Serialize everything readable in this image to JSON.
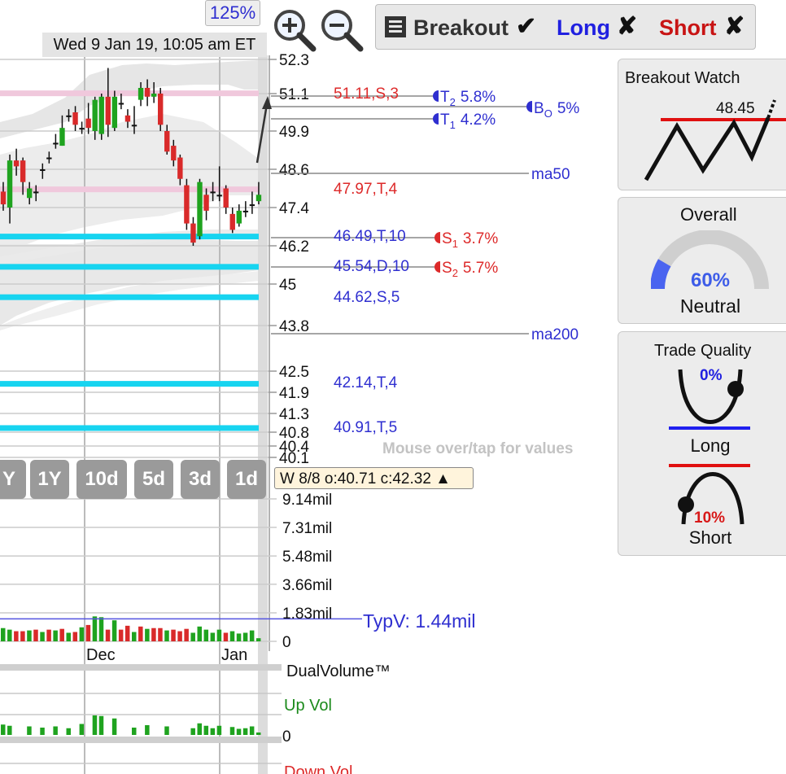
{
  "header": {
    "zoom_level": "125%",
    "timestamp": "Wed 9 Jan 19, 10:05 am ET",
    "toolbar": {
      "breakout_label": "Breakout",
      "breakout_mark": "✔",
      "long_label": "Long",
      "long_mark": "✘",
      "short_label": "Short",
      "short_mark": "✘"
    }
  },
  "range_buttons": [
    "Y",
    "1Y",
    "10d",
    "5d",
    "3d",
    "1d"
  ],
  "info_box": "W 8/8 o:40.71 c:42.32 ▲",
  "mouse_hint": "Mouse over/tap for values",
  "price_axis": {
    "ticks": [
      "52.3",
      "51.1",
      "49.9",
      "48.6",
      "47.4",
      "46.2",
      "45",
      "43.8",
      "42.5",
      "41.9",
      "41.3",
      "40.8",
      "40.4",
      "40.1"
    ]
  },
  "annotations": [
    {
      "text": "51.11,S,3",
      "color": "#dd2a2a"
    },
    {
      "text": "47.97,T,4",
      "color": "#dd2a2a"
    },
    {
      "text": "46.49,T,10",
      "color": "#2f2fd0"
    },
    {
      "text": "45.54,D,10",
      "color": "#2f2fd0"
    },
    {
      "text": "44.62,S,5",
      "color": "#2f2fd0"
    },
    {
      "text": "42.14,T,4",
      "color": "#2f2fd0"
    },
    {
      "text": "40.91,T,5",
      "color": "#2f2fd0"
    }
  ],
  "targets": {
    "t2": {
      "letter": "T",
      "sub": "2",
      "value": "5.8%"
    },
    "t1": {
      "letter": "T",
      "sub": "1",
      "value": "4.2%"
    },
    "bo": {
      "letter": "B",
      "sub": "O",
      "value": "5%"
    },
    "s1": {
      "letter": "S",
      "sub": "1",
      "value": "3.7%"
    },
    "s2": {
      "letter": "S",
      "sub": "2",
      "value": "5.7%"
    }
  },
  "ma_labels": {
    "ma50": "ma50",
    "ma200": "ma200"
  },
  "volume_axis": {
    "ticks": [
      "9.14mil",
      "7.31mil",
      "5.48mil",
      "3.66mil",
      "1.83mil",
      "0"
    ],
    "typv": "TypV: 1.44mil"
  },
  "month_labels": [
    "Dec",
    "Jan"
  ],
  "dual_volume": {
    "title": "DualVolume™",
    "up": "Up Vol",
    "zero": "0",
    "down": "Down Vol"
  },
  "panels": {
    "breakout_watch": {
      "title": "Breakout Watch",
      "level": "48.45"
    },
    "overall": {
      "title": "Overall",
      "percent": "60%",
      "label": "Neutral",
      "value": 0.6
    },
    "trade_quality": {
      "title": "Trade Quality",
      "long_pct": "0%",
      "long_label": "Long",
      "short_pct": "10%",
      "short_label": "Short"
    }
  },
  "colors": {
    "up": "#1fa31f",
    "down": "#d92a2a",
    "support": "#17d4f0",
    "resistance": "#f0c8dc",
    "blue_text": "#2f2fd0",
    "red_text": "#dd2a2a",
    "green_text": "#1b8a1b"
  },
  "chart_data": {
    "type": "candlestick",
    "ylim": [
      40.1,
      52.3
    ],
    "levels": [
      {
        "price": 51.11,
        "kind": "resistance"
      },
      {
        "price": 47.97,
        "kind": "resistance"
      },
      {
        "price": 46.49,
        "kind": "support"
      },
      {
        "price": 45.54,
        "kind": "support"
      },
      {
        "price": 44.62,
        "kind": "support"
      },
      {
        "price": 42.14,
        "kind": "support"
      },
      {
        "price": 40.91,
        "kind": "support"
      }
    ],
    "candles": [
      {
        "o": 47.9,
        "c": 47.5,
        "h": 48.2,
        "l": 47.3
      },
      {
        "o": 47.4,
        "c": 48.9,
        "h": 49.1,
        "l": 46.9
      },
      {
        "o": 48.9,
        "c": 48.7,
        "h": 49.3,
        "l": 48.4
      },
      {
        "o": 48.9,
        "c": 48.2,
        "h": 49.0,
        "l": 47.8
      },
      {
        "o": 47.7,
        "c": 48.0,
        "h": 48.2,
        "l": 47.5
      },
      {
        "o": 47.9,
        "c": 47.9,
        "h": 48.1,
        "l": 47.6
      },
      {
        "o": 48.6,
        "c": 48.6,
        "h": 48.8,
        "l": 48.3
      },
      {
        "o": 49.0,
        "c": 49.0,
        "h": 49.2,
        "l": 48.8
      },
      {
        "o": 49.5,
        "c": 49.5,
        "h": 49.8,
        "l": 49.3
      },
      {
        "o": 49.4,
        "c": 50.0,
        "h": 50.4,
        "l": 49.4
      },
      {
        "o": 50.4,
        "c": 50.4,
        "h": 50.6,
        "l": 50.2
      },
      {
        "o": 50.5,
        "c": 50.1,
        "h": 50.7,
        "l": 49.9
      },
      {
        "o": 50.0,
        "c": 50.0,
        "h": 50.2,
        "l": 49.8
      },
      {
        "o": 50.3,
        "c": 50.0,
        "h": 50.8,
        "l": 49.8
      },
      {
        "o": 49.9,
        "c": 50.9,
        "h": 51.0,
        "l": 49.6
      },
      {
        "o": 49.8,
        "c": 51.0,
        "h": 51.1,
        "l": 49.6
      },
      {
        "o": 51.0,
        "c": 50.1,
        "h": 52.0,
        "l": 49.7
      },
      {
        "o": 50.0,
        "c": 51.0,
        "h": 51.2,
        "l": 49.9
      },
      {
        "o": 50.8,
        "c": 50.8,
        "h": 51.1,
        "l": 50.6
      },
      {
        "o": 50.4,
        "c": 50.2,
        "h": 50.6,
        "l": 50.0
      },
      {
        "o": 50.1,
        "c": 50.1,
        "h": 50.7,
        "l": 49.8
      },
      {
        "o": 50.9,
        "c": 51.3,
        "h": 51.5,
        "l": 50.7
      },
      {
        "o": 51.3,
        "c": 51.0,
        "h": 51.6,
        "l": 50.7
      },
      {
        "o": 51.0,
        "c": 51.1,
        "h": 51.5,
        "l": 50.8
      },
      {
        "o": 51.1,
        "c": 50.1,
        "h": 51.3,
        "l": 49.9
      },
      {
        "o": 49.9,
        "c": 49.2,
        "h": 50.1,
        "l": 49.1
      },
      {
        "o": 49.4,
        "c": 48.9,
        "h": 49.6,
        "l": 48.7
      },
      {
        "o": 49.0,
        "c": 48.3,
        "h": 49.1,
        "l": 48.1
      },
      {
        "o": 48.1,
        "c": 46.9,
        "h": 48.3,
        "l": 46.7
      },
      {
        "o": 46.9,
        "c": 46.3,
        "h": 47.1,
        "l": 46.2
      },
      {
        "o": 46.5,
        "c": 48.2,
        "h": 48.3,
        "l": 46.4
      },
      {
        "o": 47.8,
        "c": 47.3,
        "h": 48.0,
        "l": 47.0
      },
      {
        "o": 47.9,
        "c": 47.9,
        "h": 48.2,
        "l": 47.6
      },
      {
        "o": 47.8,
        "c": 47.8,
        "h": 48.7,
        "l": 47.6
      },
      {
        "o": 48.0,
        "c": 47.4,
        "h": 48.1,
        "l": 47.2
      },
      {
        "o": 47.2,
        "c": 46.7,
        "h": 47.4,
        "l": 46.6
      },
      {
        "o": 46.9,
        "c": 47.3,
        "h": 47.5,
        "l": 46.8
      },
      {
        "o": 47.3,
        "c": 47.3,
        "h": 47.6,
        "l": 47.1
      },
      {
        "o": 47.5,
        "c": 47.5,
        "h": 47.9,
        "l": 47.2
      },
      {
        "o": 47.6,
        "c": 47.8,
        "h": 48.2,
        "l": 47.5
      }
    ],
    "volume": {
      "ylim": [
        0,
        9.14
      ],
      "typical": 1.44,
      "bars": [
        {
          "v": 0.85,
          "up": true
        },
        {
          "v": 0.75,
          "up": true
        },
        {
          "v": 0.65,
          "up": false
        },
        {
          "v": 0.65,
          "up": false
        },
        {
          "v": 0.7,
          "up": true
        },
        {
          "v": 0.75,
          "up": false
        },
        {
          "v": 0.6,
          "up": true
        },
        {
          "v": 0.75,
          "up": false
        },
        {
          "v": 0.7,
          "up": true
        },
        {
          "v": 0.8,
          "up": false
        },
        {
          "v": 0.55,
          "up": true
        },
        {
          "v": 0.6,
          "up": false
        },
        {
          "v": 0.9,
          "up": true
        },
        {
          "v": 1.05,
          "up": false
        },
        {
          "v": 1.6,
          "up": true
        },
        {
          "v": 1.55,
          "up": true
        },
        {
          "v": 0.75,
          "up": false
        },
        {
          "v": 1.35,
          "up": true
        },
        {
          "v": 0.75,
          "up": false
        },
        {
          "v": 1.0,
          "up": false
        },
        {
          "v": 0.6,
          "up": true
        },
        {
          "v": 0.95,
          "up": false
        },
        {
          "v": 0.8,
          "up": true
        },
        {
          "v": 0.85,
          "up": false
        },
        {
          "v": 0.85,
          "up": false
        },
        {
          "v": 0.7,
          "up": true
        },
        {
          "v": 0.75,
          "up": false
        },
        {
          "v": 0.65,
          "up": false
        },
        {
          "v": 0.8,
          "up": false
        },
        {
          "v": 0.55,
          "up": true
        },
        {
          "v": 0.95,
          "up": true
        },
        {
          "v": 0.75,
          "up": true
        },
        {
          "v": 0.55,
          "up": true
        },
        {
          "v": 0.75,
          "up": true
        },
        {
          "v": 0.55,
          "up": false
        },
        {
          "v": 0.65,
          "up": true
        },
        {
          "v": 0.5,
          "up": true
        },
        {
          "v": 0.55,
          "up": true
        },
        {
          "v": 0.7,
          "up": true
        },
        {
          "v": 0.2,
          "up": true
        }
      ]
    }
  }
}
